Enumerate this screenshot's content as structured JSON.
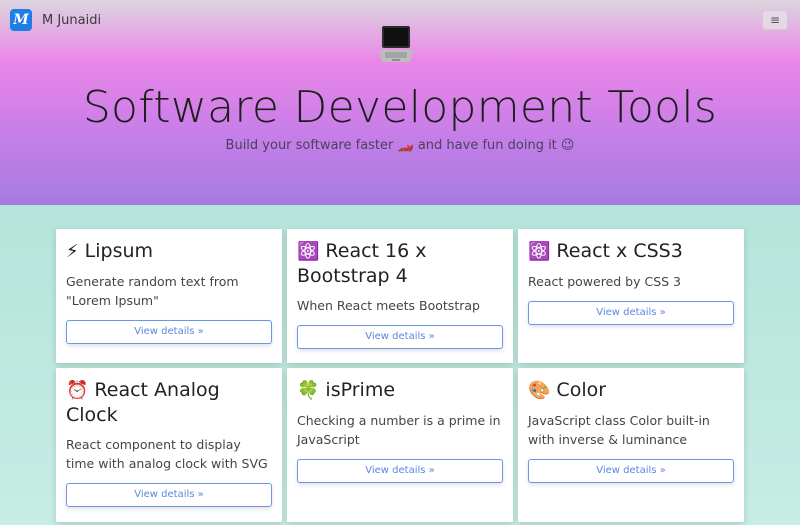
{
  "navbar": {
    "logo_text": "M",
    "brand_name": "M Junaidi",
    "menu_icon": "≡"
  },
  "hero": {
    "icon": "laptop-icon",
    "title": "Software Development Tools",
    "subtitle": "Build your software faster 🏎️ and have fun doing it 😉"
  },
  "cards": [
    {
      "emoji": "⚡",
      "title": "Lipsum",
      "text": "Generate random text from \"Lorem Ipsum\"",
      "button": "View details »"
    },
    {
      "emoji": "⚛️",
      "title": "React 16 x Bootstrap 4",
      "text": "When React meets Bootstrap",
      "button": "View details »"
    },
    {
      "emoji": "⚛️",
      "title": "React x CSS3",
      "text": "React powered by CSS 3",
      "button": "View details »"
    },
    {
      "emoji": "⏰",
      "title": "React Analog Clock",
      "text": "React component to display time with analog clock with SVG",
      "button": "View details »"
    },
    {
      "emoji": "🍀",
      "title": "isPrime",
      "text": "Checking a number is a prime in JavaScript",
      "button": "View details »"
    },
    {
      "emoji": "🎨",
      "title": "Color",
      "text": "JavaScript class Color built-in with inverse & luminance",
      "button": "View details »"
    }
  ],
  "colors": {
    "accent": "#1f7de6",
    "button_text": "#5a86e0",
    "hero_top": "#ea86e8",
    "hero_bottom": "#a67be0",
    "background": "#a8e0d3"
  }
}
